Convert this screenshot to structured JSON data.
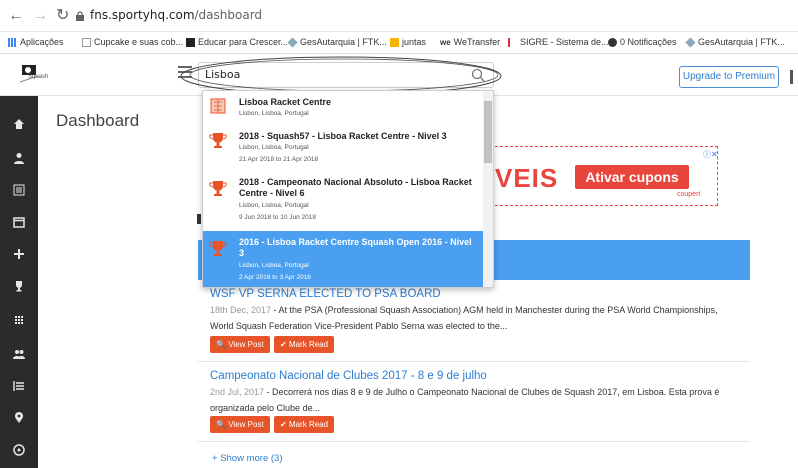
{
  "browser": {
    "url_domain": "fns.sportyhq.com",
    "url_path": "/dashboard",
    "bookmarks": [
      "Aplicações",
      "Cupcake e suas cob...",
      "Educar para Crescer...",
      "GesAutarquia | FTK...",
      "juntas",
      "WeTransfer",
      "SIGRE - Sistema de...",
      "0 Notificações",
      "GesAutarquia | FTK..."
    ]
  },
  "header": {
    "logo_text": "Squash",
    "search_value": "Lisboa",
    "upgrade_label": "Upgrade to Premium"
  },
  "page": {
    "title": "Dashboard"
  },
  "ad": {
    "big_text": "VEIS",
    "button": "Ativar cupons",
    "brand": "coupert"
  },
  "dropdown": {
    "items": [
      {
        "title": "Lisboa Racket Centre",
        "location": "Lisbon, Lisboa, Portugal",
        "dates": ""
      },
      {
        "title": "2018 - Squash57 - Lisboa Racket Centre - Nivel 3",
        "location": "Lisbon, Lisboa, Portugal",
        "dates": "21 Apr 2018 to 21 Apr 2018"
      },
      {
        "title": "2018 - Campeonato Nacional Absoluto - Lisboa Racket Centre - Nivel 6",
        "location": "Lisbon, Lisboa, Portugal",
        "dates": "9 Jun 2018 to 10 Jun 2018"
      },
      {
        "title": "2016 - Lisboa Racket Centre Squash Open 2016 - Nivel 3",
        "location": "Lisbon, Lisboa, Portugal",
        "dates": "2 Apr 2016 to 3 Apr 2016"
      }
    ]
  },
  "news": [
    {
      "title": "WSF VP SERNA ELECTED TO PSA BOARD",
      "date": "18th Dec, 2017",
      "text": " - At the PSA (Professional Squash Association) AGM held in Manchester during the PSA World Championships, World Squash Federation Vice-President Pablo Serna was elected to the...",
      "view": "View Post",
      "mark": "Mark Read"
    },
    {
      "title": "Campeonato Nacional de Clubes 2017 - 8 e 9 de julho",
      "date": "2nd Jul, 2017",
      "text": " - Decorrerá nos dias 8 e 9 de Julho o Campeonato Nacional de Clubes de Squash 2017, em Lisboa. Esta prova é organizada pelo Clube de...",
      "view": "View Post",
      "mark": "Mark Read"
    }
  ],
  "show_more": "Show more (3)",
  "colors": {
    "accent": "#4a9ff0",
    "sidebar": "#2b2b2b",
    "action": "#e8542a",
    "ad": "#e8453c",
    "trophy": "#e8542a"
  }
}
